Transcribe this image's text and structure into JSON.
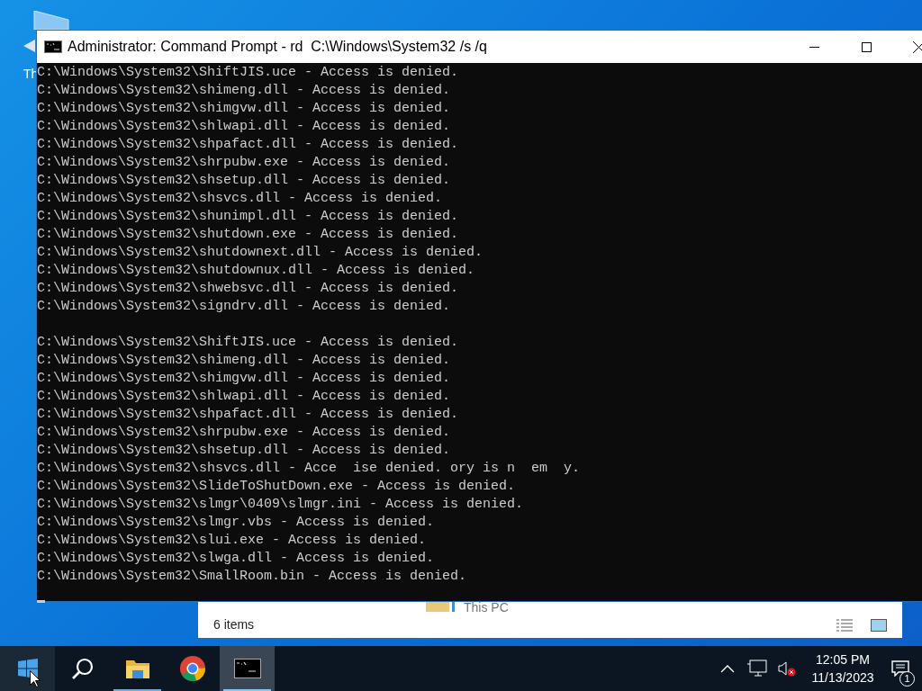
{
  "desktop": {
    "icon_label": "Th"
  },
  "window": {
    "title": "Administrator: Command Prompt - rd  C:\\Windows\\System32 /s /q",
    "blocks": [
      [
        "C:\\Windows\\System32\\ShiftJIS.uce - Access is denied.",
        "C:\\Windows\\System32\\shimeng.dll - Access is denied.",
        "C:\\Windows\\System32\\shimgvw.dll - Access is denied.",
        "C:\\Windows\\System32\\shlwapi.dll - Access is denied.",
        "C:\\Windows\\System32\\shpafact.dll - Access is denied.",
        "C:\\Windows\\System32\\shrpubw.exe - Access is denied.",
        "C:\\Windows\\System32\\shsetup.dll - Access is denied.",
        "C:\\Windows\\System32\\shsvcs.dll - Access is denied.",
        "C:\\Windows\\System32\\shunimpl.dll - Access is denied.",
        "C:\\Windows\\System32\\shutdown.exe - Access is denied.",
        "C:\\Windows\\System32\\shutdownext.dll - Access is denied.",
        "C:\\Windows\\System32\\shutdownux.dll - Access is denied.",
        "C:\\Windows\\System32\\shwebsvc.dll - Access is denied.",
        "C:\\Windows\\System32\\signdrv.dll - Access is denied."
      ],
      [
        "C:\\Windows\\System32\\ShiftJIS.uce - Access is denied.",
        "C:\\Windows\\System32\\shimeng.dll - Access is denied.",
        "C:\\Windows\\System32\\shimgvw.dll - Access is denied.",
        "C:\\Windows\\System32\\shlwapi.dll - Access is denied.",
        "C:\\Windows\\System32\\shpafact.dll - Access is denied.",
        "C:\\Windows\\System32\\shrpubw.exe - Access is denied.",
        "C:\\Windows\\System32\\shsetup.dll - Access is denied.",
        "C:\\Windows\\System32\\shsvcs.dll - Acce  ise denied. ory is n  em  y.",
        "C:\\Windows\\System32\\SlideToShutDown.exe - Access is denied.",
        "C:\\Windows\\System32\\slmgr\\0409\\slmgr.ini - Access is denied.",
        "C:\\Windows\\System32\\slmgr.vbs - Access is denied.",
        "C:\\Windows\\System32\\slui.exe - Access is denied.",
        "C:\\Windows\\System32\\slwga.dll - Access is denied.",
        "C:\\Windows\\System32\\SmallRoom.bin - Access is denied."
      ]
    ]
  },
  "explorer": {
    "location": "This PC",
    "status": "6 items"
  },
  "taskbar": {
    "apps": [
      {
        "kind": "start",
        "running": false,
        "selected": false
      },
      {
        "kind": "search",
        "running": false,
        "selected": false
      },
      {
        "kind": "files",
        "running": true,
        "selected": false
      },
      {
        "kind": "browser",
        "running": false,
        "selected": false
      },
      {
        "kind": "terminal",
        "running": true,
        "selected": true
      }
    ],
    "volume_muted": true,
    "time": "12:05 PM",
    "date": "11/13/2023",
    "notifications": "1"
  }
}
